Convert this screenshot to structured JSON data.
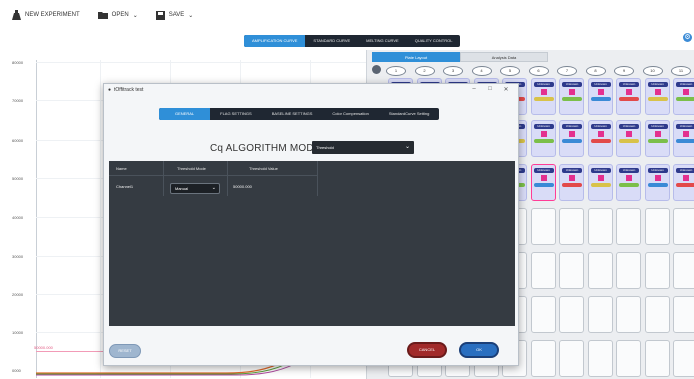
{
  "toolbar": {
    "new_experiment": "NEW EXPERIMENT",
    "open": "OPEN",
    "save": "SAVE"
  },
  "top_tabs": [
    "AMPLIFICATION CURVE",
    "STANDARD CURVE",
    "MELTING CURVE",
    "QUALITY CONTROL"
  ],
  "top_tab_active": 0,
  "chart": {
    "y_ticks": [
      "80000",
      "70000",
      "60000",
      "50000",
      "40000",
      "30000",
      "20000",
      "10000",
      "0000"
    ],
    "threshold_label": "50000.000"
  },
  "plate": {
    "tabs": [
      "Plate Layout",
      "Analysis Data"
    ],
    "active_tab": 0,
    "columns": [
      "1",
      "2",
      "3",
      "4",
      "5",
      "6",
      "7",
      "8",
      "9",
      "10",
      "11"
    ],
    "well_label": "Unknown",
    "tag_colors": [
      "#e24a4a",
      "#d8c24a",
      "#7bbf4a",
      "#3a8ad6"
    ]
  },
  "dialog": {
    "title": "tOffitrack test",
    "tabs": [
      "GENERAL",
      "FLAG SETTINGS",
      "BASELINE SETTINGS",
      "Color Compensation",
      "StandardCurve Setting"
    ],
    "active_tab": 0,
    "cq_label": "Cq ALGORITHM MODE",
    "cq_value": "Threshold",
    "table": {
      "headers": [
        "Name",
        "Threshold Mode",
        "Threshold Value"
      ],
      "rows": [
        {
          "name": "Channel1",
          "mode": "Manual",
          "value": "50000.000"
        }
      ]
    },
    "buttons": {
      "reset": "RESET",
      "cancel": "CANCEL",
      "ok": "OK"
    }
  },
  "colors": {
    "accent": "#2f8fd8",
    "dark_panel": "#353b42",
    "well_fill": "#d9dcf7",
    "well_dot": "#e3308f",
    "cancel": "#a12a2a",
    "ok": "#2a6fc0"
  }
}
